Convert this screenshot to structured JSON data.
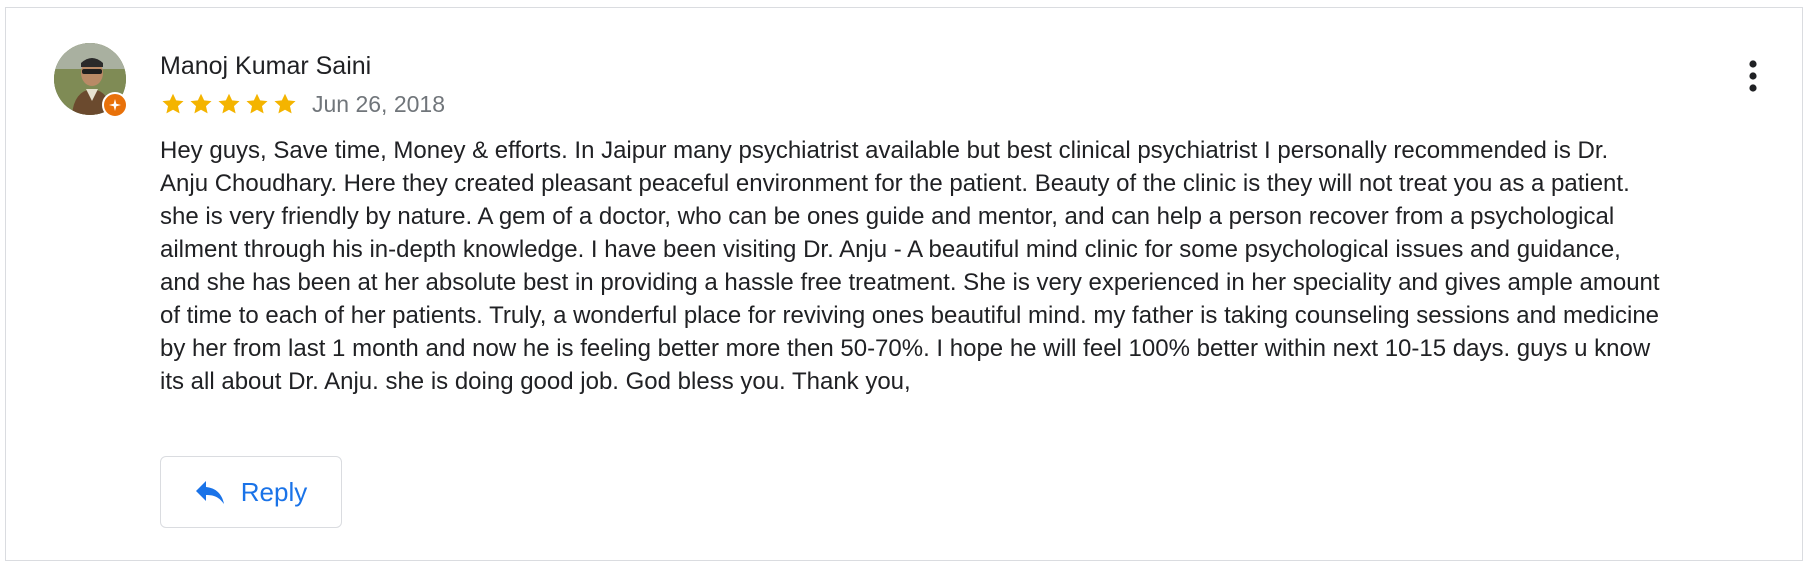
{
  "review": {
    "author_name": "Manoj Kumar Saini",
    "rating": 5,
    "rating_max": 5,
    "date": "Jun 26, 2018",
    "text": "Hey guys, Save time, Money & efforts. In Jaipur many psychiatrist available but best clinical psychiatrist I personally recommended is Dr. Anju Choudhary. Here they created pleasant peaceful environment for the patient. Beauty of the clinic is they will not treat you as a patient. she is very friendly by nature. A gem of a doctor, who can be ones guide and mentor, and can help a person recover from a psychological ailment through his in-depth knowledge. I have been visiting Dr. Anju - A beautiful mind clinic for some psychological issues and guidance, and she has been at her absolute best in providing a hassle free treatment. She is very experienced in her speciality and gives ample amount of time to each of her patients. Truly, a wonderful place for reviving ones beautiful mind. my father is taking counseling sessions and medicine by her from last 1 month and now he is feeling better more then 50-70%. I hope he will feel 100% better within next 10-15 days. guys u know its all about Dr. Anju. she is doing good job. God bless you. Thank you,"
  },
  "actions": {
    "reply_label": "Reply"
  },
  "icons": {
    "avatar": "avatar-photo",
    "badge": "local-guide-icon",
    "star": "star-icon",
    "more": "more-vert-icon",
    "reply": "reply-arrow-icon"
  },
  "colors": {
    "star": "#f4b400",
    "accent": "#1a73e8",
    "badge": "#e8710a",
    "text": "#202124",
    "secondary_text": "#70757a",
    "border": "#dadce0"
  }
}
